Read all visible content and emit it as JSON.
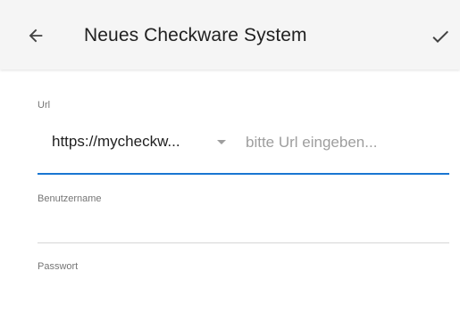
{
  "appbar": {
    "title": "Neues Checkware System",
    "back_icon": "arrow-left-icon",
    "confirm_icon": "checkmark-icon",
    "background": "#f5f5f5"
  },
  "url_field": {
    "label": "Url",
    "select_value": "https://mycheckw...",
    "placeholder": "bitte Url eingeben...",
    "accent": "#1976d2"
  },
  "username_field": {
    "label": "Benutzername",
    "value": ""
  },
  "password_field": {
    "label": "Passwort",
    "value": ""
  }
}
